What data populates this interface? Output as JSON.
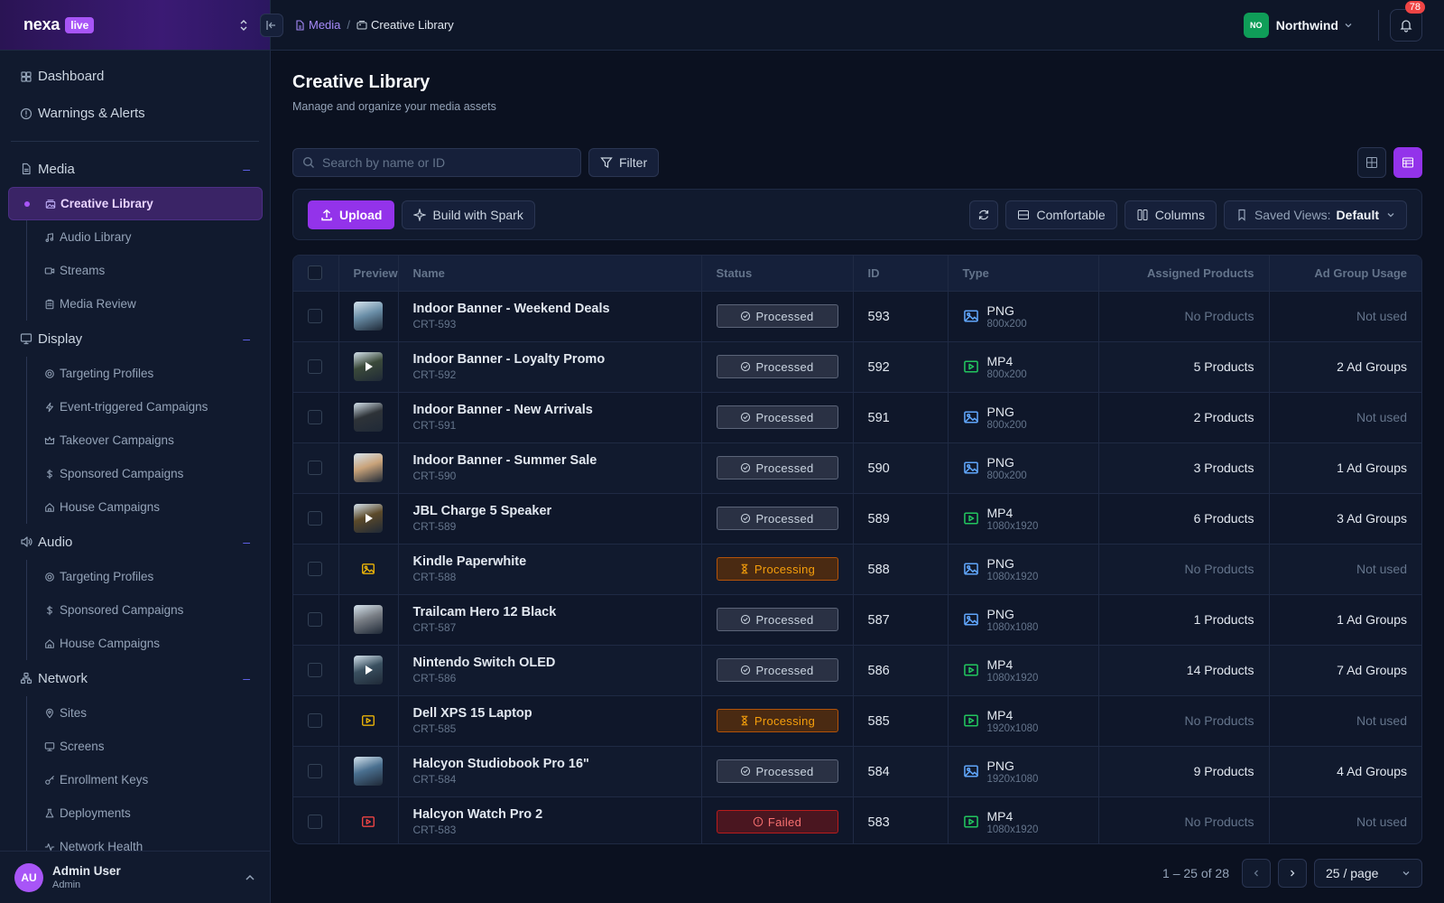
{
  "brand": {
    "name": "nexa",
    "badge": "live"
  },
  "topbar": {
    "breadcrumb": [
      {
        "label": "Media",
        "icon": "document-icon"
      },
      {
        "label": "Creative Library",
        "icon": "gallery-icon"
      }
    ],
    "org": {
      "initials": "NO",
      "name": "Northwind",
      "color": "#0f9d58"
    },
    "notifications": {
      "count": "78"
    }
  },
  "sidebar": {
    "top": [
      {
        "label": "Dashboard",
        "icon": "grid-icon"
      },
      {
        "label": "Warnings & Alerts",
        "icon": "alert-circle-icon"
      }
    ],
    "sections": [
      {
        "label": "Media",
        "icon": "document-icon",
        "items": [
          {
            "label": "Creative Library",
            "icon": "gallery-icon",
            "active": true
          },
          {
            "label": "Audio Library",
            "icon": "music-icon"
          },
          {
            "label": "Streams",
            "icon": "video-icon"
          },
          {
            "label": "Media Review",
            "icon": "clipboard-icon"
          }
        ]
      },
      {
        "label": "Display",
        "icon": "monitor-icon",
        "items": [
          {
            "label": "Targeting Profiles",
            "icon": "target-icon"
          },
          {
            "label": "Event-triggered Campaigns",
            "icon": "bolt-icon"
          },
          {
            "label": "Takeover Campaigns",
            "icon": "crown-icon"
          },
          {
            "label": "Sponsored Campaigns",
            "icon": "dollar-icon"
          },
          {
            "label": "House Campaigns",
            "icon": "home-icon"
          }
        ]
      },
      {
        "label": "Audio",
        "icon": "speaker-icon",
        "items": [
          {
            "label": "Targeting Profiles",
            "icon": "target-icon"
          },
          {
            "label": "Sponsored Campaigns",
            "icon": "dollar-icon"
          },
          {
            "label": "House Campaigns",
            "icon": "home-icon"
          }
        ]
      },
      {
        "label": "Network",
        "icon": "network-icon",
        "items": [
          {
            "label": "Sites",
            "icon": "pin-icon"
          },
          {
            "label": "Screens",
            "icon": "screen-icon"
          },
          {
            "label": "Enrollment Keys",
            "icon": "key-icon"
          },
          {
            "label": "Deployments",
            "icon": "flask-icon"
          },
          {
            "label": "Network Health",
            "icon": "activity-icon"
          }
        ]
      }
    ],
    "user": {
      "initials": "AU",
      "name": "Admin User",
      "role": "Admin"
    }
  },
  "page": {
    "title": "Creative Library",
    "subtitle": "Manage and organize your media assets",
    "search_placeholder": "Search by name or ID",
    "filter_label": "Filter",
    "upload_label": "Upload",
    "spark_label": "Build with Spark",
    "density_label": "Comfortable",
    "columns_label": "Columns",
    "saved_views_label": "Saved Views:",
    "saved_views_value": "Default"
  },
  "table": {
    "headers": [
      "Preview",
      "Name",
      "Status",
      "ID",
      "Type",
      "Assigned Products",
      "Ad Group Usage"
    ],
    "rows": [
      {
        "name": "Indoor Banner - Weekend Deals",
        "code": "CRT-593",
        "status": "Processed",
        "id": "593",
        "type": "PNG",
        "dim": "800x200",
        "products": "No Products",
        "adgroups": "Not used",
        "thumb": "image",
        "thumb_color": "#6b8fa8"
      },
      {
        "name": "Indoor Banner - Loyalty Promo",
        "code": "CRT-592",
        "status": "Processed",
        "id": "592",
        "type": "MP4",
        "dim": "800x200",
        "products": "5 Products",
        "adgroups": "2 Ad Groups",
        "thumb": "video",
        "thumb_color": "#3b4a3a"
      },
      {
        "name": "Indoor Banner - New Arrivals",
        "code": "CRT-591",
        "status": "Processed",
        "id": "591",
        "type": "PNG",
        "dim": "800x200",
        "products": "2 Products",
        "adgroups": "Not used",
        "thumb": "image",
        "thumb_color": "#2e3338"
      },
      {
        "name": "Indoor Banner - Summer Sale",
        "code": "CRT-590",
        "status": "Processed",
        "id": "590",
        "type": "PNG",
        "dim": "800x200",
        "products": "3 Products",
        "adgroups": "1 Ad Groups",
        "thumb": "image",
        "thumb_color": "#c9a37a"
      },
      {
        "name": "JBL Charge 5 Speaker",
        "code": "CRT-589",
        "status": "Processed",
        "id": "589",
        "type": "MP4",
        "dim": "1080x1920",
        "products": "6 Products",
        "adgroups": "3 Ad Groups",
        "thumb": "video",
        "thumb_color": "#5c4a2a"
      },
      {
        "name": "Kindle Paperwhite",
        "code": "CRT-588",
        "status": "Processing",
        "id": "588",
        "type": "PNG",
        "dim": "1080x1920",
        "products": "No Products",
        "adgroups": "Not used",
        "thumb": "placeholder-image",
        "thumb_color": "#eab308"
      },
      {
        "name": "Trailcam Hero 12 Black",
        "code": "CRT-587",
        "status": "Processed",
        "id": "587",
        "type": "PNG",
        "dim": "1080x1080",
        "products": "1 Products",
        "adgroups": "1 Ad Groups",
        "thumb": "image",
        "thumb_color": "#7a7f86"
      },
      {
        "name": "Nintendo Switch OLED",
        "code": "CRT-586",
        "status": "Processed",
        "id": "586",
        "type": "MP4",
        "dim": "1080x1920",
        "products": "14 Products",
        "adgroups": "7 Ad Groups",
        "thumb": "video",
        "thumb_color": "#3a5060"
      },
      {
        "name": "Dell XPS 15 Laptop",
        "code": "CRT-585",
        "status": "Processing",
        "id": "585",
        "type": "MP4",
        "dim": "1920x1080",
        "products": "No Products",
        "adgroups": "Not used",
        "thumb": "placeholder-video",
        "thumb_color": "#eab308"
      },
      {
        "name": "Halcyon Studiobook Pro 16\"",
        "code": "CRT-584",
        "status": "Processed",
        "id": "584",
        "type": "PNG",
        "dim": "1920x1080",
        "products": "9 Products",
        "adgroups": "4 Ad Groups",
        "thumb": "image",
        "thumb_color": "#4a7090"
      },
      {
        "name": "Halcyon Watch Pro 2",
        "code": "CRT-583",
        "status": "Failed",
        "id": "583",
        "type": "MP4",
        "dim": "1080x1920",
        "products": "No Products",
        "adgroups": "Not used",
        "thumb": "placeholder-video",
        "thumb_color": "#ef4444"
      }
    ]
  },
  "pagination": {
    "info": "1 – 25 of 28",
    "page_size": "25 / page"
  },
  "colors": {
    "accent": "#9333ea",
    "processed": "#cbd5e1",
    "processing": "#f59e0b",
    "failed": "#f87171",
    "png_icon": "#60a5fa",
    "mp4_icon": "#22c55e"
  }
}
